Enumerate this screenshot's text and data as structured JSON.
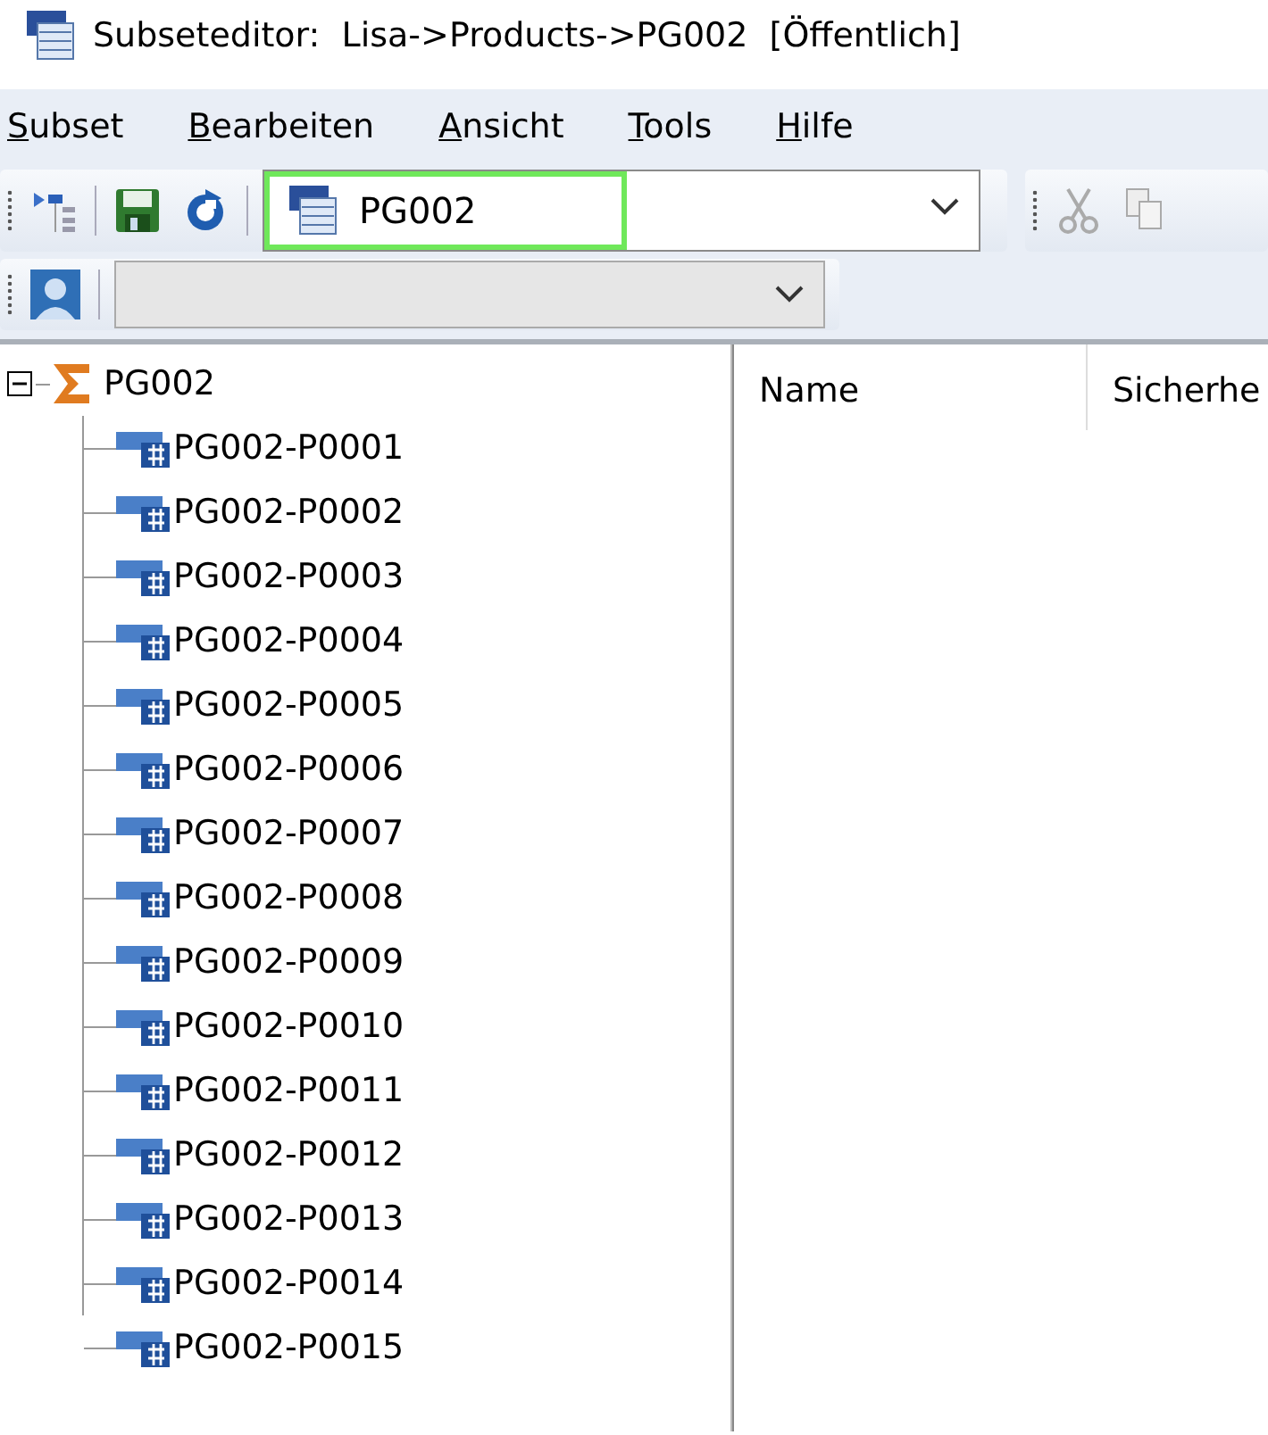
{
  "window": {
    "title": "Subseteditor:  Lisa->Products->PG002  [Öffentlich]"
  },
  "menu": [
    "Subset",
    "Bearbeiten",
    "Ansicht",
    "Tools",
    "Hilfe"
  ],
  "toolbar": {
    "subset_combo": {
      "value": "PG002",
      "highlighted": true
    },
    "edit_tools": [
      {
        "kind": "cut",
        "disabled": true
      },
      {
        "kind": "copy",
        "disabled": true
      }
    ],
    "alias_combo": {
      "disabled": true
    }
  },
  "tree": {
    "label": "PG002",
    "expanded": true,
    "children": [
      {
        "label": "PG002-P0001"
      },
      {
        "label": "PG002-P0002"
      },
      {
        "label": "PG002-P0003"
      },
      {
        "label": "PG002-P0004"
      },
      {
        "label": "PG002-P0005"
      },
      {
        "label": "PG002-P0006"
      },
      {
        "label": "PG002-P0007"
      },
      {
        "label": "PG002-P0008"
      },
      {
        "label": "PG002-P0009"
      },
      {
        "label": "PG002-P0010"
      },
      {
        "label": "PG002-P0011"
      },
      {
        "label": "PG002-P0012"
      },
      {
        "label": "PG002-P0013"
      },
      {
        "label": "PG002-P0014"
      },
      {
        "label": "PG002-P0015"
      }
    ]
  },
  "list": {
    "columns": [
      "Name",
      "Sicherhe"
    ]
  }
}
